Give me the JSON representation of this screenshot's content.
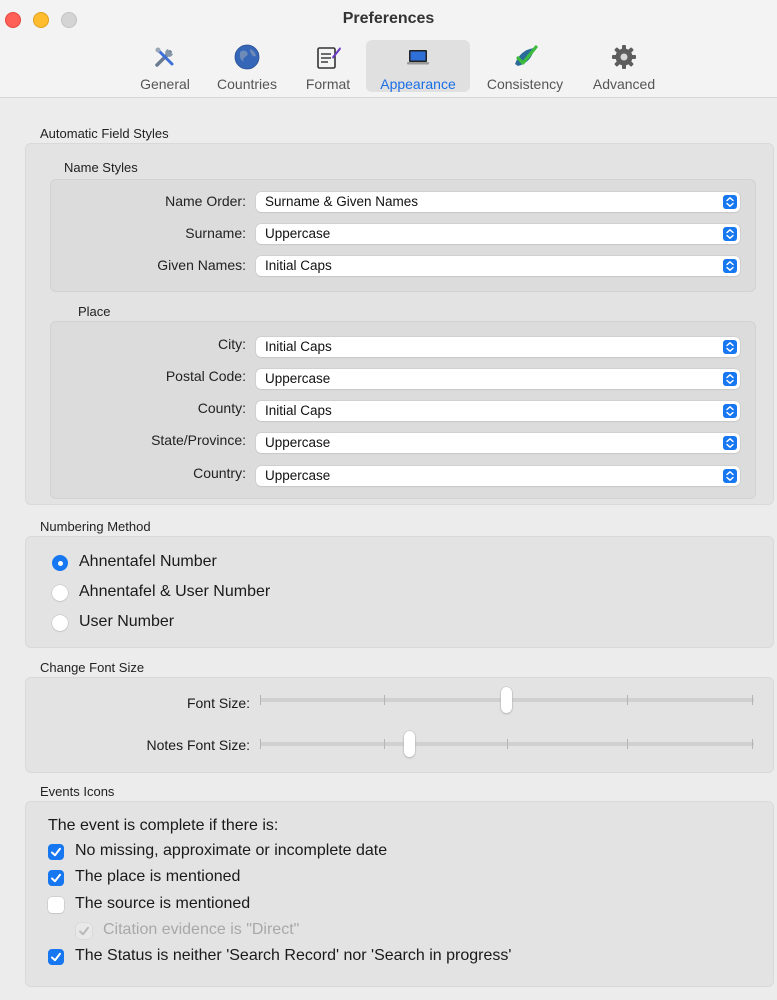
{
  "window": {
    "title": "Preferences"
  },
  "toolbar": {
    "items": [
      {
        "label": "General",
        "icon": "tools-icon",
        "selected": false
      },
      {
        "label": "Countries",
        "icon": "globe-icon",
        "selected": false
      },
      {
        "label": "Format",
        "icon": "format-icon",
        "selected": false
      },
      {
        "label": "Appearance",
        "icon": "laptop-icon",
        "selected": true
      },
      {
        "label": "Consistency",
        "icon": "checkmark-icon",
        "selected": false
      },
      {
        "label": "Advanced",
        "icon": "gear-icon",
        "selected": false
      }
    ]
  },
  "auto_field_styles": {
    "title": "Automatic Field Styles",
    "name_styles": {
      "title": "Name Styles",
      "rows": [
        {
          "label": "Name Order:",
          "value": "Surname & Given Names"
        },
        {
          "label": "Surname:",
          "value": "Uppercase"
        },
        {
          "label": "Given Names:",
          "value": "Initial Caps"
        }
      ]
    },
    "place": {
      "title": "Place",
      "rows": [
        {
          "label": "City:",
          "value": "Initial Caps"
        },
        {
          "label": "Postal Code:",
          "value": "Uppercase"
        },
        {
          "label": "County:",
          "value": "Initial Caps"
        },
        {
          "label": "State/Province:",
          "value": "Uppercase"
        },
        {
          "label": "Country:",
          "value": "Uppercase"
        }
      ]
    }
  },
  "numbering": {
    "title": "Numbering Method",
    "options": [
      {
        "label": "Ahnentafel Number",
        "selected": true
      },
      {
        "label": "Ahnentafel & User Number",
        "selected": false
      },
      {
        "label": "User Number",
        "selected": false
      }
    ]
  },
  "font_size": {
    "title": "Change Font Size",
    "sliders": [
      {
        "label": "Font Size:",
        "position": 0.5
      },
      {
        "label": "Notes Font Size:",
        "position": 0.3
      }
    ]
  },
  "events_icons": {
    "title": "Events Icons",
    "intro": "The event is complete if there is:",
    "checks": [
      {
        "label": "No missing, approximate or incomplete date",
        "checked": true,
        "disabled": false
      },
      {
        "label": "The place is mentioned",
        "checked": true,
        "disabled": false
      },
      {
        "label": "The source is mentioned",
        "checked": false,
        "disabled": false
      },
      {
        "label": "Citation evidence is \"Direct\"",
        "checked": true,
        "disabled": true
      },
      {
        "label": "The Status is neither 'Search Record' nor 'Search in progress'",
        "checked": true,
        "disabled": false
      }
    ]
  },
  "colors": {
    "accent": "#1677f0",
    "close": "#fe5f57",
    "minimize": "#febc2e"
  }
}
